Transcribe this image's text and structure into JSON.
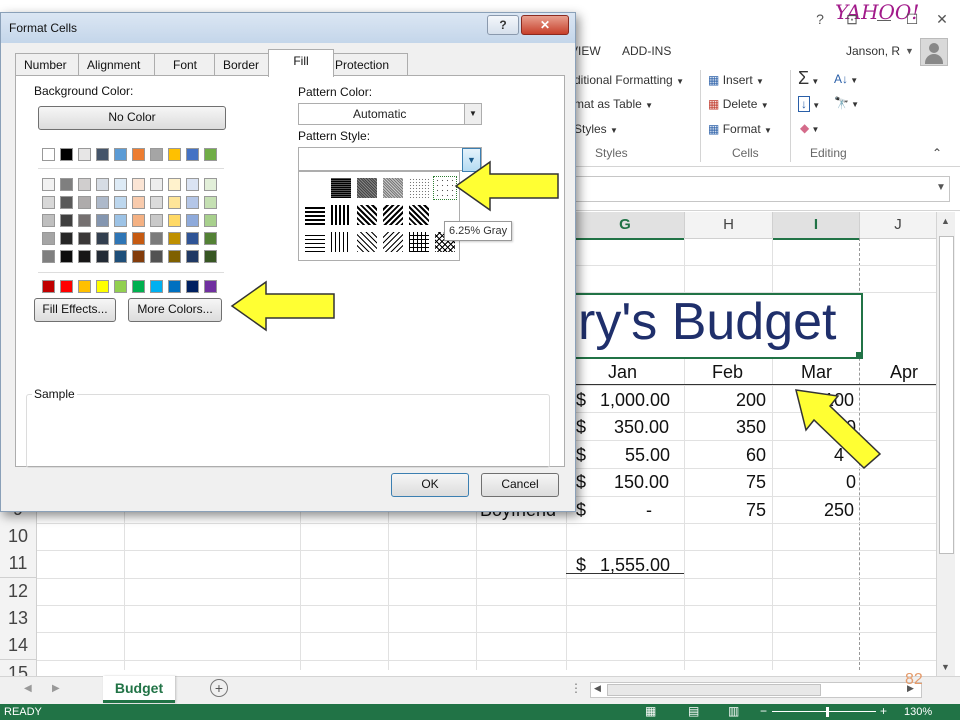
{
  "excel": {
    "window_controls": [
      "?",
      "⊡",
      "—",
      "☐",
      "✕"
    ],
    "tabs": [
      "VIEW",
      "ADD-INS"
    ],
    "account": "Janson, R",
    "ribbon": {
      "conditional_formatting": "ditional Formatting",
      "format_as_table": "mat as Table",
      "cell_styles": "Styles",
      "styles_group": "Styles",
      "insert": "Insert",
      "delete": "Delete",
      "format": "Format",
      "cells_group": "Cells",
      "editing_group": "Editing"
    },
    "columns": [
      "G",
      "H",
      "I",
      "J"
    ],
    "rows": [
      "9",
      "10",
      "11",
      "12",
      "13",
      "14",
      "15"
    ],
    "title_text": "ry's Budget",
    "months": [
      "Jan",
      "Feb",
      "Mar",
      "Apr"
    ],
    "data_rows": [
      {
        "jan_sym": "$",
        "jan": "1,000.00",
        "feb": "200",
        "mar": "100"
      },
      {
        "jan_sym": "$",
        "jan": "350.00",
        "feb": "350",
        "mar": "0"
      },
      {
        "jan_sym": "$",
        "jan": "55.00",
        "feb": "60",
        "mar": "4"
      },
      {
        "jan_sym": "$",
        "jan": "150.00",
        "feb": "75",
        "mar": "0"
      },
      {
        "label": "Boyfriend",
        "jan_sym": "$",
        "jan": "-",
        "feb": "75",
        "mar": "250"
      }
    ],
    "total": {
      "sym": "$",
      "value": "1,555.00"
    },
    "sheet_tab": "Budget",
    "status": "READY",
    "zoom": "130%",
    "slide_number": "82"
  },
  "dialog": {
    "title": "Format Cells",
    "help": "?",
    "close": "✕",
    "tabs": [
      "Number",
      "Alignment",
      "Font",
      "Border",
      "Fill",
      "Protection"
    ],
    "active_tab": "Fill",
    "background_color_label": "Background Color:",
    "no_color": "No Color",
    "fill_effects": "Fill Effects...",
    "more_colors": "More Colors...",
    "pattern_color_label": "Pattern Color:",
    "pattern_color_value": "Automatic",
    "pattern_style_label": "Pattern Style:",
    "tooltip": "6.25% Gray",
    "sample_label": "Sample",
    "ok": "OK",
    "cancel": "Cancel",
    "theme_top": [
      "#ffffff",
      "#000000",
      "#e7e6e6",
      "#44546a",
      "#5b9bd5",
      "#ed7d31",
      "#a5a5a5",
      "#ffc000",
      "#4472c4",
      "#70ad47"
    ],
    "theme_shades": [
      [
        "#f2f2f2",
        "#7f7f7f",
        "#d0cece",
        "#d6dce4",
        "#deebf6",
        "#fbe5d5",
        "#ededed",
        "#fff2cc",
        "#dae3f3",
        "#e2efd9"
      ],
      [
        "#d8d8d8",
        "#595959",
        "#aeabab",
        "#adb9ca",
        "#bdd7ee",
        "#f8cbad",
        "#dbdbdb",
        "#fee599",
        "#b4c6e7",
        "#c5e0b3"
      ],
      [
        "#bfbfbf",
        "#3f3f3f",
        "#757070",
        "#8496b0",
        "#9dc3e6",
        "#f4b183",
        "#c9c9c9",
        "#ffd965",
        "#8eaadb",
        "#a8d08d"
      ],
      [
        "#a5a5a5",
        "#262626",
        "#3a3838",
        "#323f4f",
        "#2e75b5",
        "#c55a11",
        "#7b7b7b",
        "#bf9000",
        "#2f5496",
        "#538135"
      ],
      [
        "#7f7f7f",
        "#0c0c0c",
        "#171616",
        "#222a35",
        "#1e4e79",
        "#833c0b",
        "#525252",
        "#7f6000",
        "#1f3864",
        "#375623"
      ]
    ],
    "standard": [
      "#c00000",
      "#ff0000",
      "#ffc000",
      "#ffff00",
      "#92d050",
      "#00b050",
      "#00b0f0",
      "#0070c0",
      "#002060",
      "#7030a0"
    ]
  }
}
